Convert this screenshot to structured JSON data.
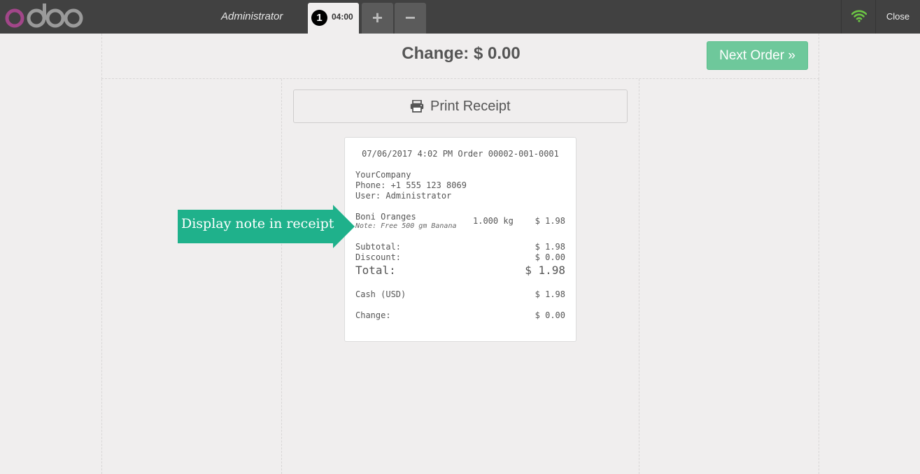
{
  "header": {
    "logo_text": "odoo",
    "username": "Administrator",
    "order_tab": {
      "number": "1",
      "time": "04:00"
    },
    "add_order_label": "+",
    "remove_order_label": "−",
    "close_label": "Close"
  },
  "screen": {
    "change_title": "Change: $ 0.00",
    "next_order_label": "Next Order",
    "print_receipt_label": "Print Receipt"
  },
  "receipt": {
    "header_line": "07/06/2017 4:02 PM Order 00002-001-0001",
    "company": "YourCompany",
    "phone": "Phone: +1 555 123 8069",
    "user": "User: Administrator",
    "lines": [
      {
        "product": "Boni Oranges",
        "note": "Note: Free 500 gm Banana",
        "qty": "1.000 kg",
        "price": "$ 1.98"
      }
    ],
    "subtotal_label": "Subtotal:",
    "subtotal_value": "$ 1.98",
    "discount_label": "Discount:",
    "discount_value": "$ 0.00",
    "total_label": "Total:",
    "total_value": "$ 1.98",
    "payment_label": "Cash (USD)",
    "payment_value": "$ 1.98",
    "change_label": "Change:",
    "change_value": "$ 0.00"
  },
  "callout": {
    "text": "Display note in receipt"
  },
  "colors": {
    "topbar": "#414141",
    "logo_o": "#a24689",
    "next_order_bg": "#6ec89b",
    "callout_bg": "#1fb18b",
    "wifi": "#6cc644"
  }
}
